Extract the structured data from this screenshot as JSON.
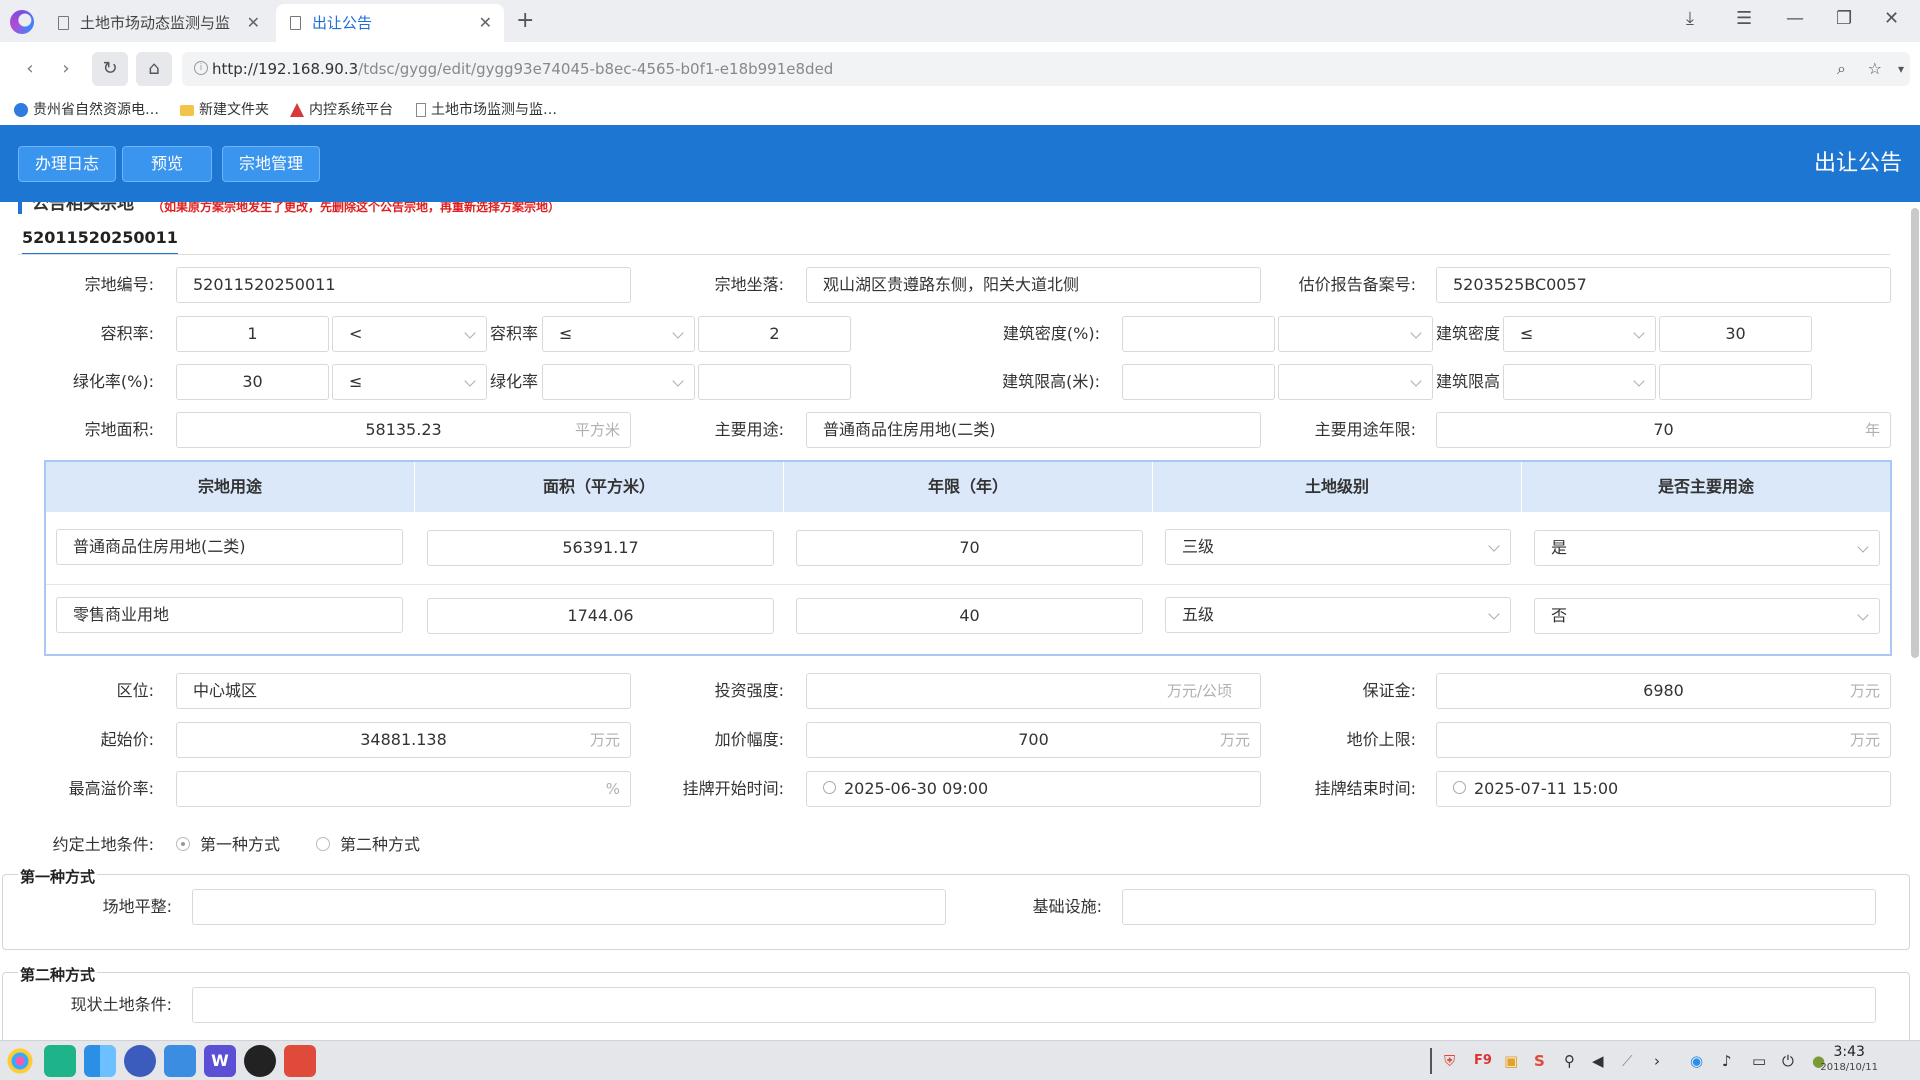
{
  "browser": {
    "tabs": [
      {
        "label": "土地市场动态监测与监管",
        "active": false
      },
      {
        "label": "出让公告",
        "active": true
      }
    ],
    "url": {
      "host": "http://192.168.90.3",
      "path": "/tdsc/gygg/edit/gygg93e74045-b8ec-4565-b0f1-e18b991e8ded"
    },
    "bookmarks": [
      "贵州省自然资源电…",
      "新建文件夹",
      "内控系统平台",
      "土地市场监测与监…"
    ]
  },
  "header": {
    "buttons": [
      "办理日志",
      "预览",
      "宗地管理"
    ],
    "title": "出让公告"
  },
  "section": {
    "title": "公告相关宗地",
    "note": "（如果原方案宗地发生了更改，先删除这个公告宗地，再重新选择方案宗地）",
    "parcel_tab": "52011520250011"
  },
  "form": {
    "parcel_no_label": "宗地编号:",
    "parcel_no": "52011520250011",
    "location_label": "宗地坐落:",
    "location": "观山湖区贵遵路东侧，阳关大道北侧",
    "appraisal_label": "估价报告备案号:",
    "appraisal_no": "5203525BC0057",
    "far_label": "容积率:",
    "far_min": "1",
    "far_op1": "<",
    "far_mid_label": "容积率",
    "far_op2": "≤",
    "far_max": "2",
    "density_label": "建筑密度(%):",
    "density_min": "",
    "density_op1": "",
    "density_mid_label": "建筑密度",
    "density_op2": "≤",
    "density_max": "30",
    "green_label": "绿化率(%):",
    "green_min": "30",
    "green_op1": "≤",
    "green_mid_label": "绿化率",
    "green_op2": "",
    "green_max": "",
    "height_label": "建筑限高(米):",
    "height_min": "",
    "height_op1": "",
    "height_mid_label": "建筑限高",
    "height_op2": "",
    "height_max": "",
    "area_label": "宗地面积:",
    "area": "58135.23",
    "area_unit": "平方米",
    "main_use_label": "主要用途:",
    "main_use": "普通商品住房用地(二类)",
    "main_use_years_label": "主要用途年限:",
    "main_use_years": "70",
    "years_unit": "年",
    "zone_label": "区位:",
    "zone": "中心城区",
    "invest_label": "投资强度:",
    "invest": "",
    "invest_unit": "万元/公顷",
    "deposit_label": "保证金:",
    "deposit": "6980",
    "wan_unit": "万元",
    "start_price_label": "起始价:",
    "start_price": "34881.138",
    "increment_label": "加价幅度:",
    "increment": "700",
    "cap_label": "地价上限:",
    "cap": "",
    "premium_label": "最高溢价率:",
    "premium": "",
    "percent_unit": "%",
    "list_start_label": "挂牌开始时间:",
    "list_start": "2025-06-30 09:00",
    "list_end_label": "挂牌结束时间:",
    "list_end": "2025-07-11 15:00",
    "condition_label": "约定土地条件:",
    "condition_opt1": "第一种方式",
    "condition_opt2": "第二种方式"
  },
  "use_table": {
    "headers": [
      "宗地用途",
      "面积（平方米）",
      "年限（年）",
      "土地级别",
      "是否主要用途"
    ],
    "rows": [
      {
        "use": "普通商品住房用地(二类)",
        "area": "56391.17",
        "years": "70",
        "grade": "三级",
        "main": "是"
      },
      {
        "use": "零售商业用地",
        "area": "1744.06",
        "years": "40",
        "grade": "五级",
        "main": "否"
      }
    ]
  },
  "method1": {
    "legend": "第一种方式",
    "site_label": "场地平整:",
    "site": "",
    "infra_label": "基础设施:",
    "infra": ""
  },
  "method2": {
    "legend": "第二种方式",
    "status_label": "现状土地条件:",
    "status": ""
  },
  "taskbar": {
    "time": "3:43",
    "date": "2018/10/11"
  }
}
